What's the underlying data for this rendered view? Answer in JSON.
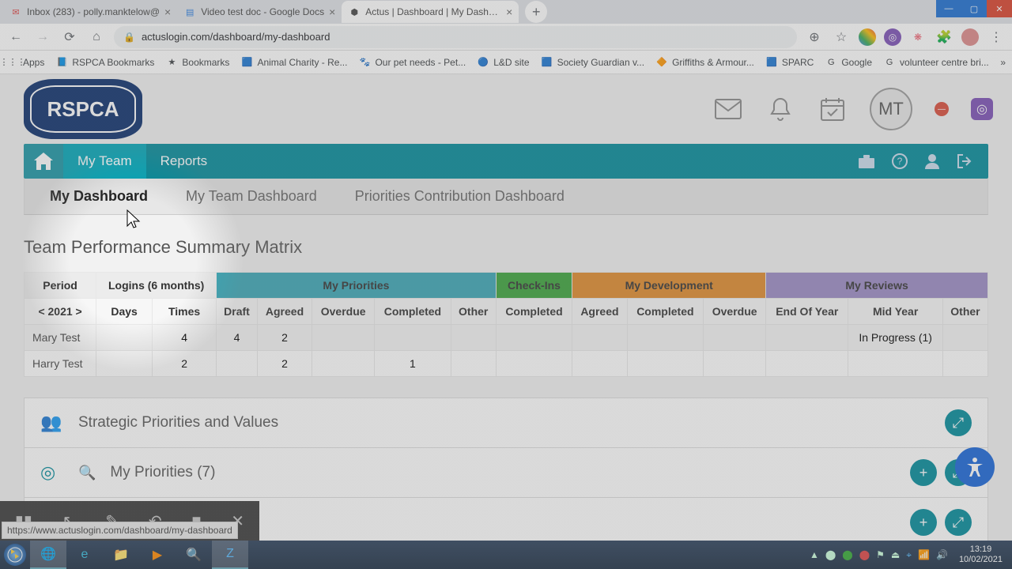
{
  "window": {
    "min": "—",
    "max": "▢",
    "close": "✕"
  },
  "tabs": [
    {
      "title": "Inbox (283) - polly.manktelow@",
      "favicon": "M"
    },
    {
      "title": "Video test doc - Google Docs",
      "favicon": "📄"
    },
    {
      "title": "Actus | Dashboard | My Dashboa",
      "favicon": "⚙"
    }
  ],
  "url": "actuslogin.com/dashboard/my-dashboard",
  "bookmarks": [
    {
      "label": "Apps",
      "icon": "⋮⋮⋮"
    },
    {
      "label": "RSPCA Bookmarks",
      "icon": "📘"
    },
    {
      "label": "Bookmarks",
      "icon": "★"
    },
    {
      "label": "Animal Charity - Re...",
      "icon": "🟦"
    },
    {
      "label": "Our pet needs - Pet...",
      "icon": "🐾"
    },
    {
      "label": "L&D site",
      "icon": "🔵"
    },
    {
      "label": "Society Guardian v...",
      "icon": "🟦"
    },
    {
      "label": "Griffiths & Armour...",
      "icon": "🔶"
    },
    {
      "label": "SPARC",
      "icon": "🟦"
    },
    {
      "label": "Google",
      "icon": "G"
    },
    {
      "label": "volunteer centre bri...",
      "icon": "G"
    }
  ],
  "logo": "RSPCA",
  "avatar": "MT",
  "nav": {
    "home": "⌂",
    "items": [
      "My Team",
      "Reports"
    ],
    "activeIndex": 0
  },
  "subtabs": [
    "My Dashboard",
    "My Team Dashboard",
    "Priorities Contribution Dashboard"
  ],
  "subtabActive": 0,
  "sectionTitle": "Team Performance Summary Matrix",
  "matrix": {
    "groups": [
      {
        "label": "Period",
        "span": 1,
        "cls": "gh-period"
      },
      {
        "label": "Logins (6 months)",
        "span": 2,
        "cls": "gh-logins"
      },
      {
        "label": "My Priorities",
        "span": 5,
        "cls": "gh-priorities"
      },
      {
        "label": "Check-Ins",
        "span": 1,
        "cls": "gh-checkins"
      },
      {
        "label": "My Development",
        "span": 3,
        "cls": "gh-dev"
      },
      {
        "label": "My Reviews",
        "span": 3,
        "cls": "gh-reviews"
      }
    ],
    "cols": [
      "< 2021 >",
      "Days",
      "Times",
      "Draft",
      "Agreed",
      "Overdue",
      "Completed",
      "Other",
      "Completed",
      "Agreed",
      "Completed",
      "Overdue",
      "End Of Year",
      "Mid Year",
      "Other"
    ],
    "rows": [
      {
        "name": "Mary Test",
        "cells": [
          "",
          "4",
          "4",
          "2",
          "",
          "",
          "",
          "",
          "",
          "",
          "",
          "",
          "In Progress (1)",
          ""
        ]
      },
      {
        "name": "Harry Test",
        "cells": [
          "",
          "2",
          "",
          "2",
          "",
          "1",
          "",
          "",
          "",
          "",
          "",
          "",
          "",
          ""
        ]
      }
    ]
  },
  "panels": [
    {
      "title": "Strategic Priorities and Values",
      "icon": "👥",
      "actions": [
        "expand"
      ]
    },
    {
      "title": "My Priorities (7)",
      "icon": "🎯",
      "extra": "search",
      "actions": [
        "add",
        "expand"
      ]
    },
    {
      "title": "",
      "icon": "",
      "actions": [
        "add",
        "expand"
      ]
    }
  ],
  "statusUrl": "https://www.actuslogin.com/dashboard/my-dashboard",
  "tray": {
    "time": "13:19",
    "date": "10/02/2021"
  },
  "colors": {
    "teal": "#008a9a",
    "tealLight": "#00a6b8",
    "navy": "#0a2d6b"
  }
}
